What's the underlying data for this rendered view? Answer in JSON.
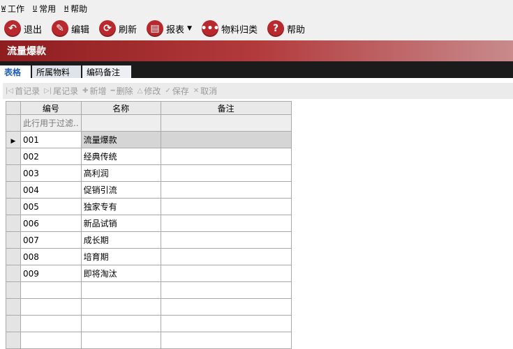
{
  "menu": [
    {
      "key": "W",
      "label": "工作"
    },
    {
      "key": "U",
      "label": "常用"
    },
    {
      "key": "H",
      "label": "帮助"
    }
  ],
  "toolbar": {
    "exit": "退出",
    "edit": "编辑",
    "refresh": "刷新",
    "report": "报表",
    "classify": "物料归类",
    "help": "帮助"
  },
  "title": "流量爆款",
  "tabs": [
    "表格",
    "所属物料",
    "编码备注"
  ],
  "gridbar": {
    "first": "首记录",
    "last": "尾记录",
    "add": "新增",
    "delete": "删除",
    "modify": "修改",
    "save": "保存",
    "cancel": "取消"
  },
  "grid": {
    "headers": [
      "编号",
      "名称",
      "备注"
    ],
    "filter_placeholder": "此行用于过滤..",
    "rows": [
      {
        "code": "001",
        "name": "流量爆款",
        "note": ""
      },
      {
        "code": "002",
        "name": "经典传统",
        "note": ""
      },
      {
        "code": "003",
        "name": "高利润",
        "note": ""
      },
      {
        "code": "004",
        "name": "促销引流",
        "note": ""
      },
      {
        "code": "005",
        "name": "独家专有",
        "note": ""
      },
      {
        "code": "006",
        "name": "新品试销",
        "note": ""
      },
      {
        "code": "007",
        "name": "成长期",
        "note": ""
      },
      {
        "code": "008",
        "name": "培育期",
        "note": ""
      },
      {
        "code": "009",
        "name": "即将淘汰",
        "note": ""
      }
    ]
  },
  "colors": {
    "accent": "#b8282c",
    "title_band": "#8e1d1f",
    "tab_active": "#1f5fb5"
  }
}
